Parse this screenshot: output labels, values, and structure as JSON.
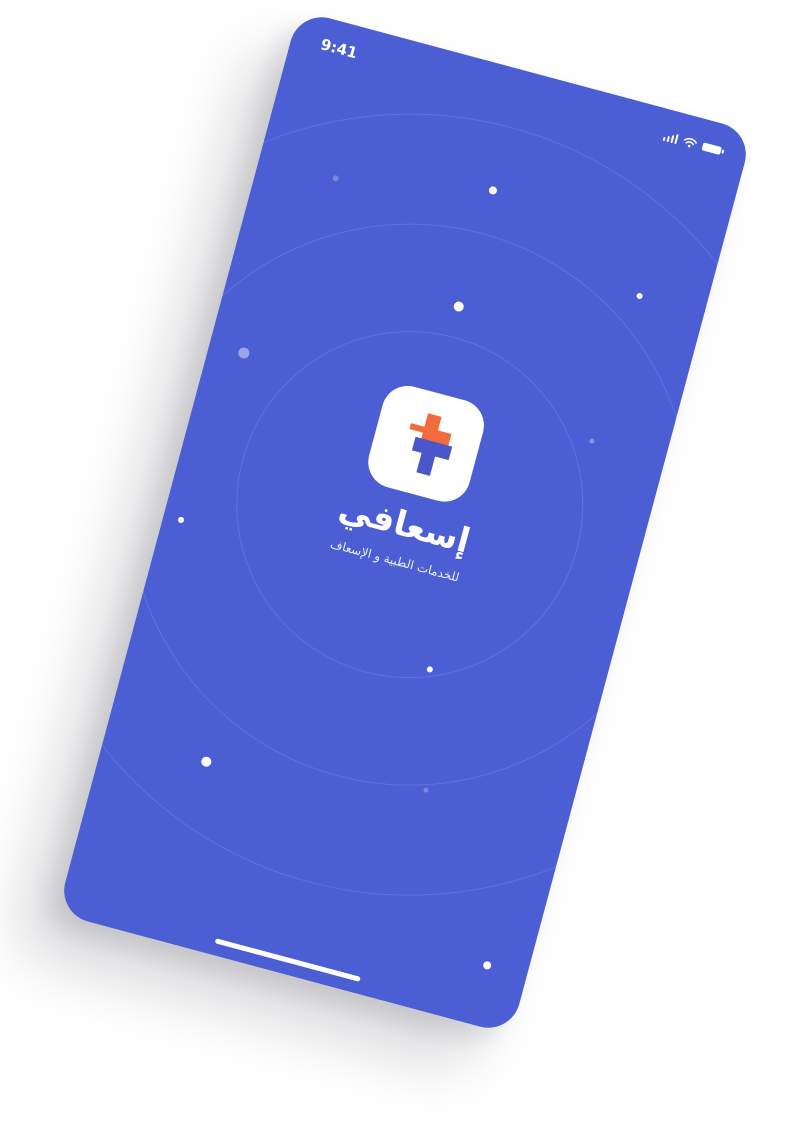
{
  "status_bar": {
    "time": "9:41",
    "signal_icon": "cellular-signal-icon",
    "wifi_icon": "wifi-icon",
    "battery_icon": "battery-icon"
  },
  "splash": {
    "app_icon": "medical-cross-logo-icon",
    "brand_name": "إسعافي",
    "tagline": "للخدمات الطبية و الإسعاف"
  },
  "colors": {
    "background": "#4b5ed3",
    "logo_orange": "#f26b3a",
    "logo_indigo": "#4a56c9",
    "icon_tile": "#ffffff"
  }
}
